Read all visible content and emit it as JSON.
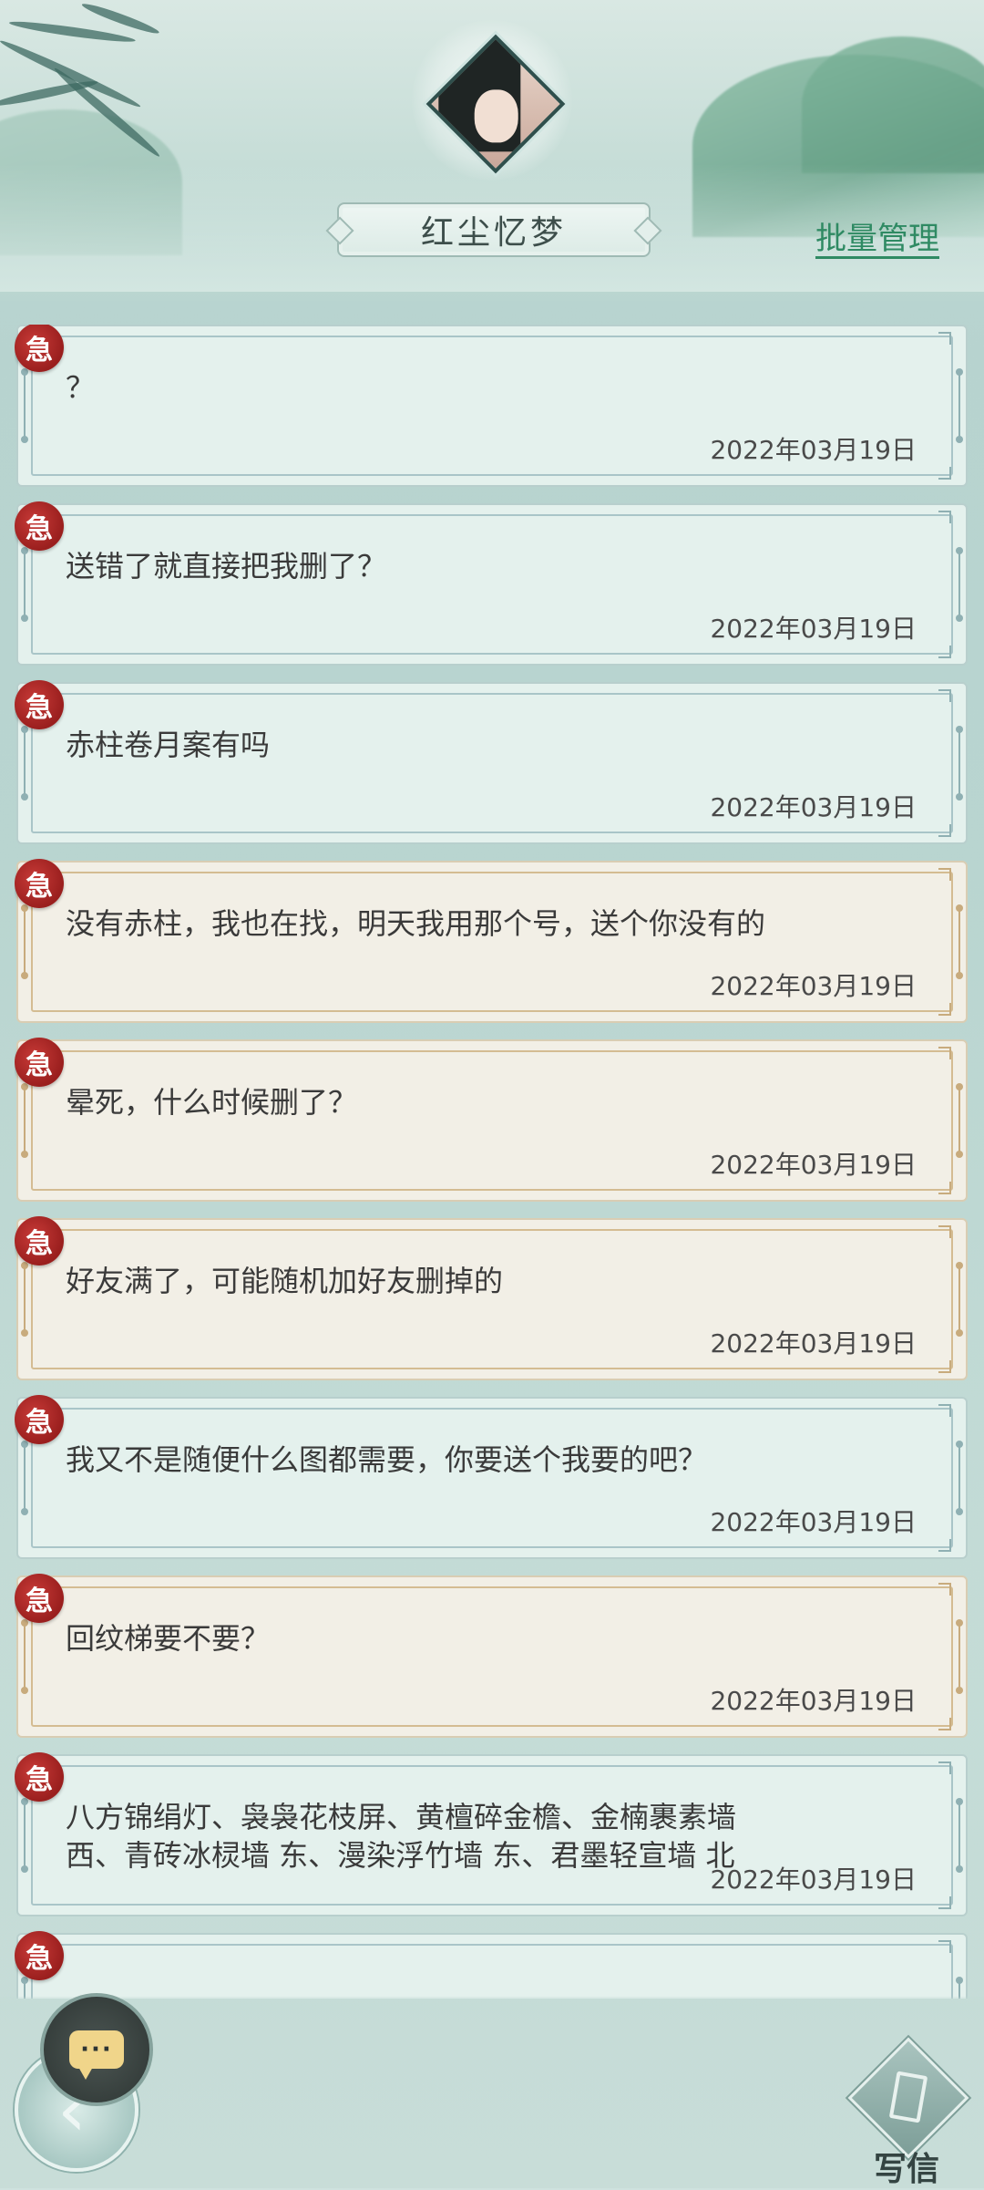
{
  "header": {
    "title": "红尘忆梦",
    "batch_manage": "批量管理",
    "avatar_icon": "character-portrait"
  },
  "seal_char": "急",
  "messages": [
    {
      "text": "？",
      "date": "2022年03月19日",
      "style": "blue"
    },
    {
      "text": "送错了就直接把我删了？",
      "date": "2022年03月19日",
      "style": "blue"
    },
    {
      "text": "赤柱卷月案有吗",
      "date": "2022年03月19日",
      "style": "blue"
    },
    {
      "text": "没有赤柱，我也在找，明天我用那个号，送个你没有的",
      "date": "2022年03月19日",
      "style": "tan"
    },
    {
      "text": "晕死，什么时候删了？",
      "date": "2022年03月19日",
      "style": "tan"
    },
    {
      "text": "好友满了，可能随机加好友删掉的",
      "date": "2022年03月19日",
      "style": "tan"
    },
    {
      "text": "我又不是随便什么图都需要，你要送个我要的吧？",
      "date": "2022年03月19日",
      "style": "blue"
    },
    {
      "text": "回纹梯要不要？",
      "date": "2022年03月19日",
      "style": "tan"
    },
    {
      "text": "八方锦绢灯、袅袅花枝屏、黄檀碎金檐、金楠裹素墙\n西、青砖冰棂墙 东、漫染浮竹墙 东、君墨轻宣墙 北",
      "date": "2022年03月19日",
      "style": "blue"
    },
    {
      "text": "",
      "date": "",
      "style": "blue"
    }
  ],
  "bottom": {
    "chat_icon": "chat-bubble-icon",
    "back_icon": "back-arrow-icon",
    "write_label": "写信"
  }
}
